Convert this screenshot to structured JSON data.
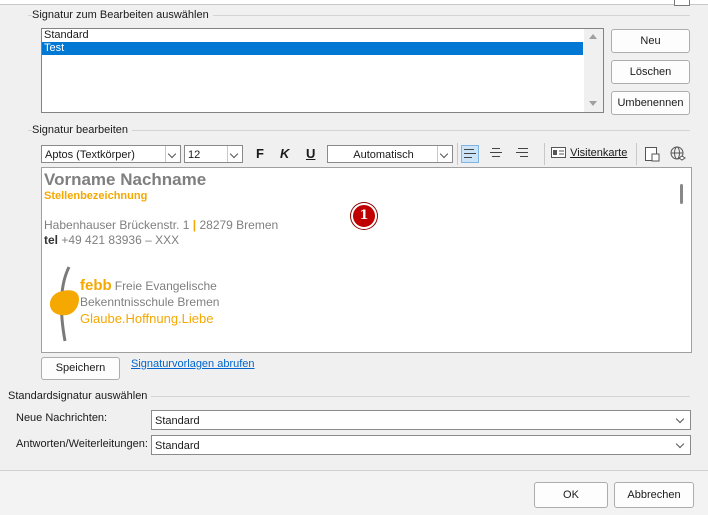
{
  "select_section": {
    "label": "Signatur zum Bearbeiten auswählen",
    "items": [
      "Standard",
      "Test"
    ],
    "selected_index": 1
  },
  "side_buttons": {
    "new": "Neu",
    "delete": "Löschen",
    "rename": "Umbenennen"
  },
  "edit_section": {
    "label": "Signatur bearbeiten",
    "font": "Aptos (Textkörper)",
    "size": "12",
    "bold": "F",
    "italic": "K",
    "underline": "U",
    "color": "Automatisch",
    "business_card": "Visitenkarte"
  },
  "signature": {
    "name": "Vorname Nachname",
    "title": "Stellenbezeichnung",
    "address_street": "Habenhauser Brückenstr. 1",
    "address_sep": "|",
    "address_city": "28279 Bremen",
    "tel_label": "tel",
    "tel_number": "+49 421 83936 – XXX",
    "logo_abbr": "febb",
    "logo_line1": "Freie Evangelische",
    "logo_line2": "Bekenntnisschule Bremen",
    "logo_line3": "Glaube.Hoffnung.Liebe",
    "marker": "1",
    "name_color": "#7f7f7f",
    "accent_color": "#f5a800",
    "marker_color": "#c00000"
  },
  "save_row": {
    "save": "Speichern",
    "templates_link": "Signaturvorlagen abrufen"
  },
  "default_section": {
    "label": "Standardsignatur auswählen",
    "new_messages_label": "Neue Nachrichten:",
    "new_messages_value": "Standard",
    "replies_label": "Antworten/Weiterleitungen:",
    "replies_value": "Standard"
  },
  "footer": {
    "ok": "OK",
    "cancel": "Abbrechen"
  }
}
